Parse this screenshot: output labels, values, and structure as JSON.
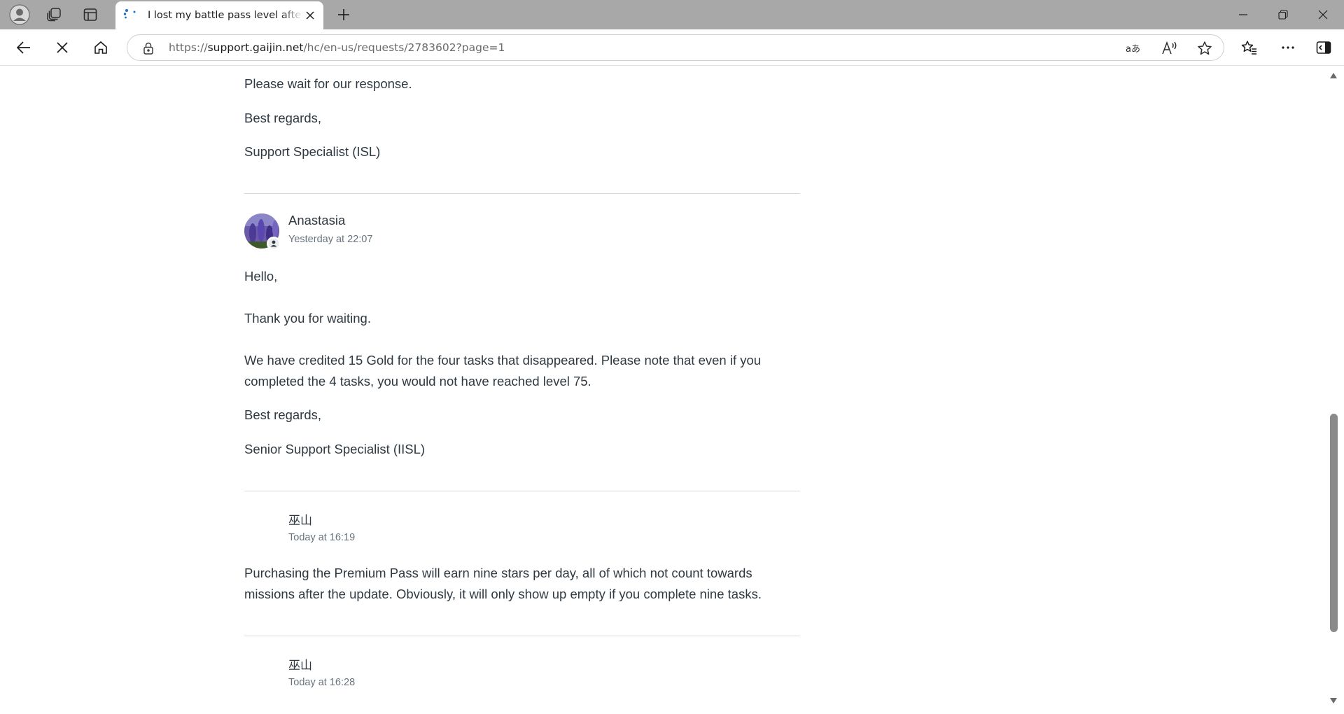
{
  "browser": {
    "tab_title": "I lost my battle pass level after last update",
    "url_scheme": "https://",
    "url_host": "support.gaijin.net",
    "url_path": "/hc/en-us/requests/2783602?page=1"
  },
  "icons": {
    "profile": "profile-icon",
    "workspaces": "workspaces-icon",
    "tab_actions": "vertical-tabs-icon",
    "loading": "loading-spinner-icon",
    "close_tab": "close-icon",
    "new_tab": "plus-icon",
    "minimize": "minimize-icon",
    "restore": "restore-icon",
    "close_window": "close-icon",
    "back": "back-arrow-icon",
    "stop": "stop-icon",
    "home": "home-icon",
    "site_info": "lock-icon",
    "translate": "translate-icon",
    "read_aloud": "read-aloud-icon",
    "favorite": "star-icon",
    "favorites": "favorites-icon",
    "more": "more-icon",
    "sidebar": "sidebar-icon"
  },
  "colors": {
    "tabstrip_bg": "#a8a8a8",
    "text": "#2f3941",
    "meta_text": "#68737d",
    "divider": "#d8dcde"
  },
  "comments": [
    {
      "lines": [
        "Please wait for our response.",
        "Best regards,",
        "Support Specialist (ISL)"
      ]
    },
    {
      "author": "Anastasia",
      "time": "Yesterday at 22:07",
      "lines": [
        "Hello,",
        "Thank you for waiting.",
        "We have credited 15 Gold for the four tasks that disappeared. Please note that even if you completed the 4 tasks, you would not have reached level 75.",
        "Best regards,",
        "Senior Support Specialist (IISL)"
      ]
    },
    {
      "author": "巫山",
      "time": "Today at 16:19",
      "lines": [
        "Purchasing the Premium Pass will earn nine stars per day, all of which not count towards missions after the update. Obviously, it will only show up empty if you complete nine tasks."
      ]
    },
    {
      "author": "巫山",
      "time": "Today at 16:28",
      "lines": []
    }
  ]
}
